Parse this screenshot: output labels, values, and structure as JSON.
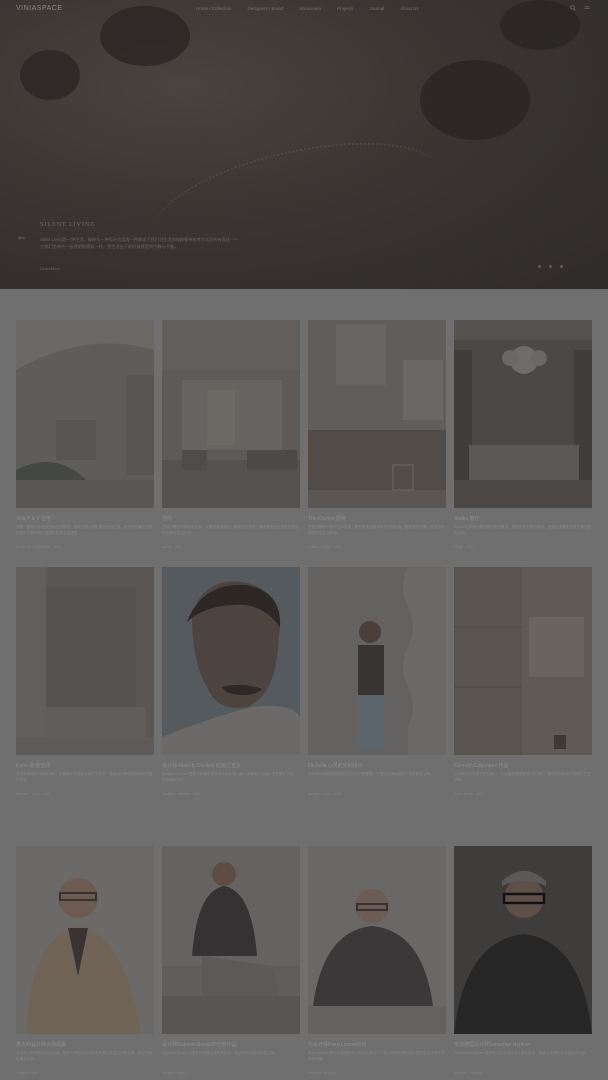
{
  "header": {
    "logo": "VINIASPACE",
    "nav": [
      "Home / Collection",
      "Designers / Brand",
      "Showroom",
      "Projects",
      "Journal",
      "About Us"
    ]
  },
  "hero": {
    "title": "SILENT LIVING",
    "description": "Silent Living是一种生活、精神与一种设计态度的一种静谧于我们对生活的纯粹看待思考方式的所有表达——它我们生命中一张透明的感知一样。想生活当下的时候感受到宁静与平衡。",
    "more": "Read More"
  },
  "row1": [
    {
      "title": "Villa P & V 住宅",
      "desc": "这是一座面向大自然的独立式居所，空间之间以弧形墙面自然过渡，赋予居住者与自然相连的宁静体验与温暖的居家生活感受。",
      "meta": "Residence · Architecture · 2023"
    },
    {
      "title": "住所",
      "desc": "空间以暖白与木色为主调，大面积落地窗引入柔和自然光线，营造静谧舒适的居住氛围与优雅的生活方式。",
      "meta": "Interior · 2023"
    },
    {
      "title": "The Kitchen 厨房",
      "desc": "开放式厨房与餐厅空间连接，橱柜采用温润木材与石材台面，搭配简约灯具，呈现质朴而精致的生活质感。",
      "meta": "Kitchen · Design · 2023"
    },
    {
      "title": "Studio 客厅",
      "desc": "Studio 以柔和的雕塑感灯具为焦点，搭配木质书柜与装饰，营造出温暖而富有艺术气息的空间。",
      "meta": "Studio · 2023"
    }
  ],
  "row2": [
    {
      "title": "Kyoto 卧室空间",
      "desc": "空间采用原木与纸质材料，以极简手法重新诠释日式美学，营造出宁静而富有禅意的居住体验。",
      "meta": "Bedroom · Japan · 2022"
    },
    {
      "title": "设计师 Rodolfo Dordoni 的独立宣言",
      "desc": "Rodolfo Dordoni 是意大利著名建筑师与设计师，他以优雅简约的设计语言闻名于世，作品遍布全球。",
      "meta": "Designer · Interview · 2023"
    },
    {
      "title": "Michelle 心灵的空间设计",
      "desc": "设计师以其敏锐的感知力与对材质的理解，打造出充满温度与个性的居住空间。",
      "meta": "Designer · Story · 2023"
    },
    {
      "title": "Kenneth Cobonpue 作品",
      "desc": "以天然材料与手工艺为核心，作品兼具雕塑美感与实用性，展现独特的设计视角与工艺精神。",
      "meta": "Craft · Design · 2022"
    }
  ],
  "row3": [
    {
      "title": "意大利设计师大师风采",
      "desc": "来自意大利的资深设计大师，用半个世纪的时间探索家具与生活之间的关系，作品风格经典且永恒。",
      "meta": "Designer · Italy"
    },
    {
      "title": "设计师Gabriele Buratti的全新作品",
      "desc": "Gabriele Buratti 以建筑师视角诠释家具设计，作品简约而富有结构之美。",
      "meta": "Designer · Milan"
    },
    {
      "title": "与设计师Piero Lissoni对话",
      "desc": "Piero Lissoni 是当代最具影响力的设计师之一，他以克制优雅的设计理念定义了现代意大利风格。",
      "meta": "Designer · Interview"
    },
    {
      "title": "专访德国设计师Sebastian Herkner",
      "desc": "Sebastian Herkner 将传统工艺与当代设计语言结合，创造出充满色彩与温度的作品。",
      "meta": "Designer · Germany"
    }
  ]
}
